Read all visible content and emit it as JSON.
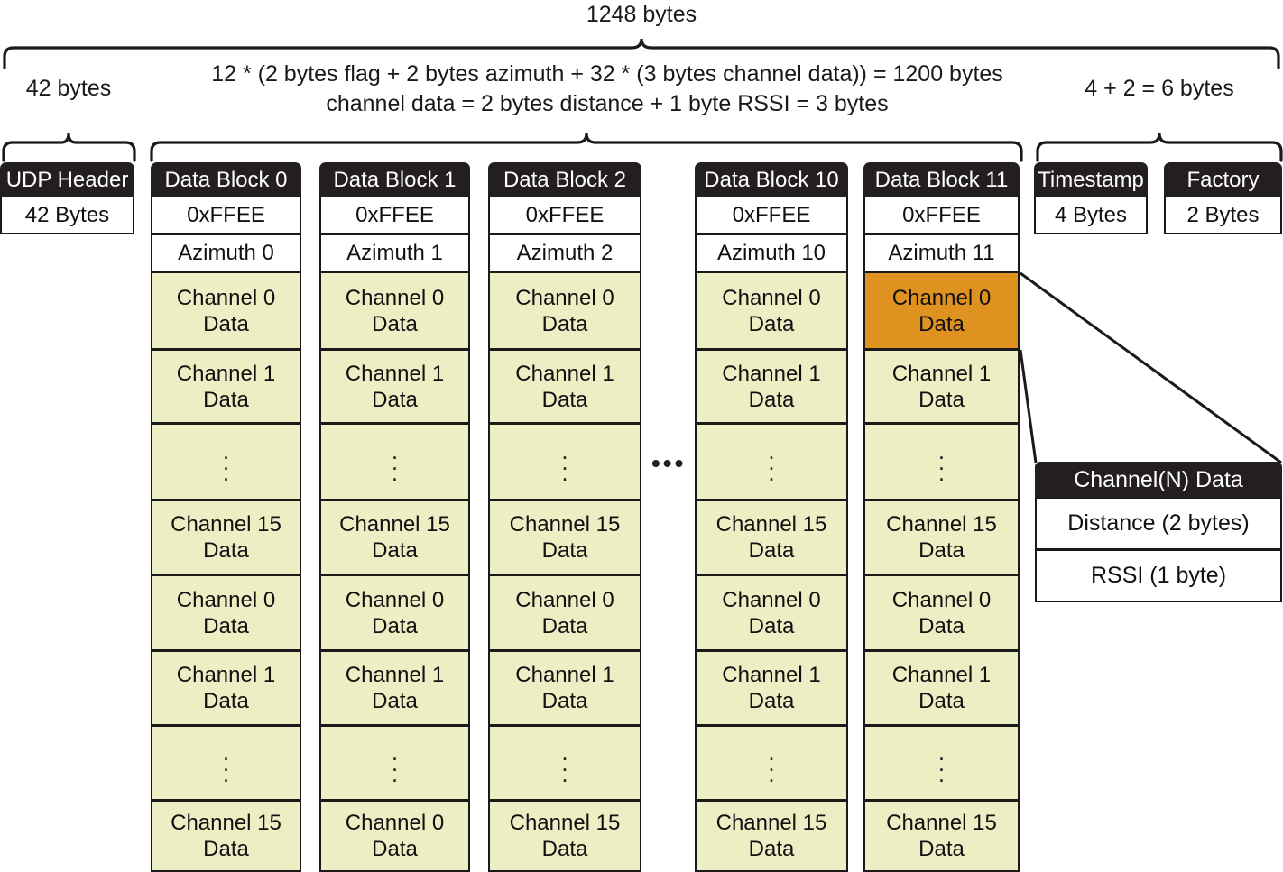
{
  "annotations": {
    "total_bytes": "1248 bytes",
    "udp_bytes": "42 bytes",
    "payload_line1": "12 * (2 bytes flag + 2 bytes azimuth + 32 * (3 bytes channel data)) = 1200 bytes",
    "payload_line2": "channel data = 2 bytes distance + 1 byte RSSI  = 3 bytes",
    "tail_bytes": "4 + 2 = 6 bytes",
    "ellipsis_between_blocks": "•••"
  },
  "columns": [
    {
      "name": "udp-header",
      "header": "UDP Header",
      "cells": [
        {
          "lines": [
            "42 Bytes"
          ],
          "style": "white"
        }
      ]
    },
    {
      "name": "data-block-0",
      "header": "Data Block 0",
      "cells": [
        {
          "lines": [
            "0xFFEE"
          ],
          "style": "white"
        },
        {
          "lines": [
            "Azimuth 0"
          ],
          "style": "white"
        },
        {
          "lines": [
            "Channel 0",
            "Data"
          ],
          "style": "yellow"
        },
        {
          "lines": [
            "Channel 1",
            "Data"
          ],
          "style": "yellow"
        },
        {
          "lines": [],
          "style": "yellow",
          "vdots": true
        },
        {
          "lines": [
            "Channel  15",
            "Data"
          ],
          "style": "yellow"
        },
        {
          "lines": [
            "Channel  0",
            "Data"
          ],
          "style": "yellow"
        },
        {
          "lines": [
            "Channel  1",
            "Data"
          ],
          "style": "yellow"
        },
        {
          "lines": [],
          "style": "yellow",
          "vdots": true
        },
        {
          "lines": [
            "Channel  15",
            "Data"
          ],
          "style": "yellow"
        }
      ]
    },
    {
      "name": "data-block-1",
      "header": "Data Block 1",
      "cells": [
        {
          "lines": [
            "0xFFEE"
          ],
          "style": "white"
        },
        {
          "lines": [
            "Azimuth 1"
          ],
          "style": "white"
        },
        {
          "lines": [
            "Channel 0",
            "Data"
          ],
          "style": "yellow"
        },
        {
          "lines": [
            "Channel 1",
            "Data"
          ],
          "style": "yellow"
        },
        {
          "lines": [],
          "style": "yellow",
          "vdots": true
        },
        {
          "lines": [
            "Channel   15",
            "Data"
          ],
          "style": "yellow"
        },
        {
          "lines": [
            "Channel  0",
            "Data"
          ],
          "style": "yellow"
        },
        {
          "lines": [
            "Channel  1",
            "Data"
          ],
          "style": "yellow"
        },
        {
          "lines": [],
          "style": "yellow",
          "vdots": true
        },
        {
          "lines": [
            "Channel  0",
            "Data"
          ],
          "style": "yellow"
        }
      ]
    },
    {
      "name": "data-block-2",
      "header": "Data Block 2",
      "cells": [
        {
          "lines": [
            "0xFFEE"
          ],
          "style": "white"
        },
        {
          "lines": [
            "Azimuth 2"
          ],
          "style": "white"
        },
        {
          "lines": [
            "Channel 0",
            "Data"
          ],
          "style": "yellow"
        },
        {
          "lines": [
            "Channel 1",
            "Data"
          ],
          "style": "yellow"
        },
        {
          "lines": [],
          "style": "yellow",
          "vdots": true
        },
        {
          "lines": [
            "Channel 15",
            "Data"
          ],
          "style": "yellow"
        },
        {
          "lines": [
            "Channel  0",
            "Data"
          ],
          "style": "yellow"
        },
        {
          "lines": [
            "Channel 1",
            "Data"
          ],
          "style": "yellow"
        },
        {
          "lines": [],
          "style": "yellow",
          "vdots": true
        },
        {
          "lines": [
            "Channel 15",
            "Data"
          ],
          "style": "yellow"
        }
      ]
    },
    {
      "name": "data-block-10",
      "header": "Data Block 10",
      "cells": [
        {
          "lines": [
            "0xFFEE"
          ],
          "style": "white"
        },
        {
          "lines": [
            "Azimuth 10"
          ],
          "style": "white"
        },
        {
          "lines": [
            "Channel 0",
            "Data"
          ],
          "style": "yellow"
        },
        {
          "lines": [
            "Channel 1",
            "Data"
          ],
          "style": "yellow"
        },
        {
          "lines": [],
          "style": "yellow",
          "vdots": true
        },
        {
          "lines": [
            "Channel 15",
            "Data"
          ],
          "style": "yellow"
        },
        {
          "lines": [
            "Channel  0",
            "Data"
          ],
          "style": "yellow"
        },
        {
          "lines": [
            "Channel  1",
            "Data"
          ],
          "style": "yellow"
        },
        {
          "lines": [],
          "style": "yellow",
          "vdots": true
        },
        {
          "lines": [
            "Channel 15",
            "Data"
          ],
          "style": "yellow"
        }
      ]
    },
    {
      "name": "data-block-11",
      "header": "Data Block 11",
      "cells": [
        {
          "lines": [
            "0xFFEE"
          ],
          "style": "white"
        },
        {
          "lines": [
            "Azimuth 11"
          ],
          "style": "white"
        },
        {
          "lines": [
            "Channel 0",
            "Data"
          ],
          "style": "orange"
        },
        {
          "lines": [
            "Channel 1",
            "Data"
          ],
          "style": "yellow"
        },
        {
          "lines": [],
          "style": "yellow",
          "vdots": true
        },
        {
          "lines": [
            "Channel 15",
            "Data"
          ],
          "style": "yellow"
        },
        {
          "lines": [
            "Channel  0",
            "Data"
          ],
          "style": "yellow"
        },
        {
          "lines": [
            "Channel  1",
            "Data"
          ],
          "style": "yellow"
        },
        {
          "lines": [],
          "style": "yellow",
          "vdots": true
        },
        {
          "lines": [
            "Channel 15",
            "Data"
          ],
          "style": "yellow"
        }
      ]
    },
    {
      "name": "timestamp",
      "header": "Timestamp",
      "cells": [
        {
          "lines": [
            "4 Bytes"
          ],
          "style": "white"
        }
      ]
    },
    {
      "name": "factory",
      "header": "Factory",
      "cells": [
        {
          "lines": [
            "2 Bytes"
          ],
          "style": "white"
        }
      ]
    }
  ],
  "callout": {
    "name": "channel-n-data-detail",
    "header": "Channel(N) Data",
    "rows": [
      {
        "label": "Distance (2 bytes)"
      },
      {
        "label": "RSSI (1 byte)"
      }
    ]
  },
  "colors": {
    "header_bg": "#231f1e",
    "channel_yellow": "#eeeec5",
    "highlight_orange": "#df9220",
    "stroke": "#1a1a1a",
    "page_bg": "#ffffff"
  }
}
